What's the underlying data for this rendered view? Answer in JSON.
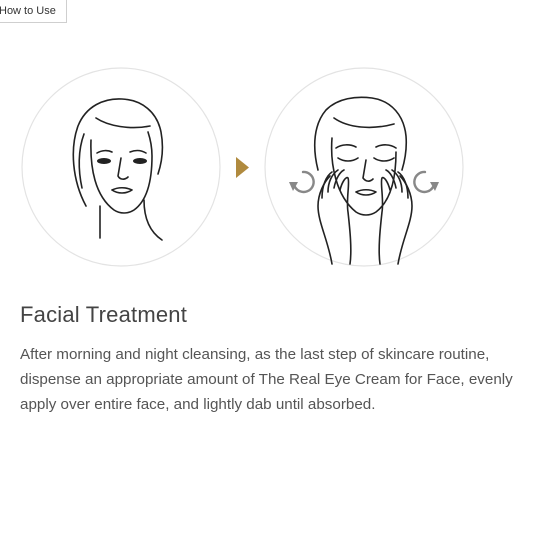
{
  "tab": {
    "label": "How to Use"
  },
  "step": {
    "title": "Facial Treatment",
    "description": "After morning and night cleansing, as the last step of skincare routine, dispense an appropriate amount of The Real Eye Cream for Face, evenly apply over entire face, and lightly dab until absorbed."
  },
  "colors": {
    "accent_arrow": "#b08a3e",
    "circle_border": "#e3e3e3",
    "rotate_icons": "#888888",
    "line_art": "#222222",
    "text": "#555555"
  },
  "icons": [
    "face-illustration-icon",
    "arrow-right-icon",
    "face-massage-illustration-icon",
    "rotate-counterclockwise-icon",
    "rotate-clockwise-icon"
  ]
}
